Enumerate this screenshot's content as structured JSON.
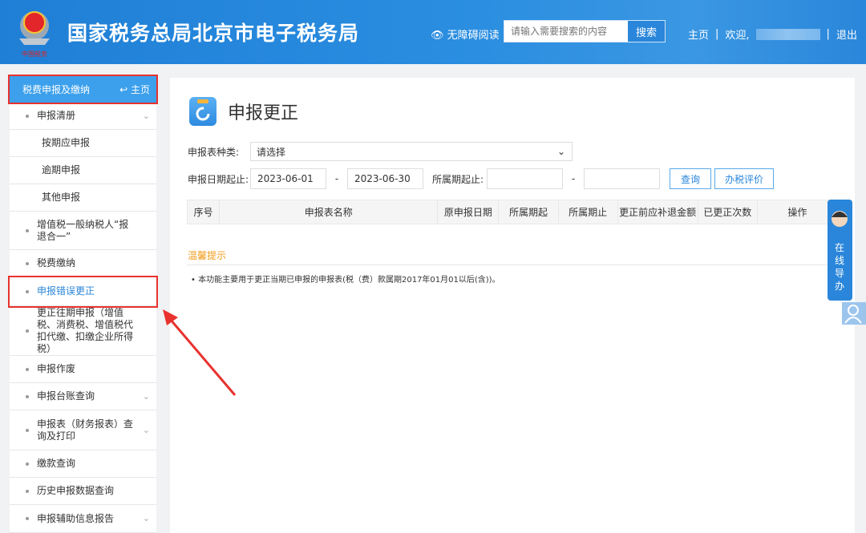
{
  "header": {
    "title": "国家税务总局北京市电子税务局",
    "emblem_text": "中国税务",
    "accessibility": "无障碍阅读",
    "search_placeholder": "请输入需要搜索的内容",
    "search_button": "搜索",
    "home": "主页",
    "welcome": "欢迎,",
    "logout": "退出",
    "sep": "|"
  },
  "sidebar": {
    "title": "税费申报及缴纳",
    "home": "主页",
    "items": [
      {
        "label": "申报清册",
        "type": "item",
        "chevron": true
      },
      {
        "label": "按期应申报",
        "type": "sub"
      },
      {
        "label": "逾期申报",
        "type": "sub"
      },
      {
        "label": "其他申报",
        "type": "sub"
      },
      {
        "label": "增值税一般纳税人“报退合一”",
        "type": "item"
      },
      {
        "label": "税费缴纳",
        "type": "item"
      },
      {
        "label": "申报错误更正",
        "type": "item",
        "active": true
      },
      {
        "label": "更正往期申报（增值税、消费税、增值税代扣代缴、扣缴企业所得税）",
        "type": "item"
      },
      {
        "label": "申报作废",
        "type": "item"
      },
      {
        "label": "申报台账查询",
        "type": "item",
        "chevron": true
      },
      {
        "label": "申报表（财务报表）查询及打印",
        "type": "item",
        "chevron": true
      },
      {
        "label": "缴款查询",
        "type": "item"
      },
      {
        "label": "历史申报数据查询",
        "type": "item"
      },
      {
        "label": "申报辅助信息报告",
        "type": "item",
        "chevron": true
      }
    ]
  },
  "main": {
    "title": "申报更正",
    "form_type_label": "申报表种类:",
    "form_type_value": "请选择",
    "date_label": "申报日期起止:",
    "date_start": "2023-06-01",
    "date_end": "2023-06-30",
    "dash": "-",
    "period_label": "所属期起止:",
    "period_start": "",
    "period_end": "",
    "query_button": "查询",
    "rate_button": "办税评价",
    "columns": [
      "序号",
      "申报表名称",
      "原申报日期",
      "所属期起",
      "所属期止",
      "更正前应补退金额",
      "已更正次数",
      "操作"
    ],
    "tip_title": "温馨提示",
    "tip": "本功能主要用于更正当期已申报的申报表(税（费）款属期2017年01月01以后(含))。"
  },
  "float": {
    "guide": "在线导办"
  },
  "colors": {
    "header": "#2a86da",
    "accent": "#2a86da",
    "highlight": "#e8322e",
    "tip": "#f39b1b"
  }
}
